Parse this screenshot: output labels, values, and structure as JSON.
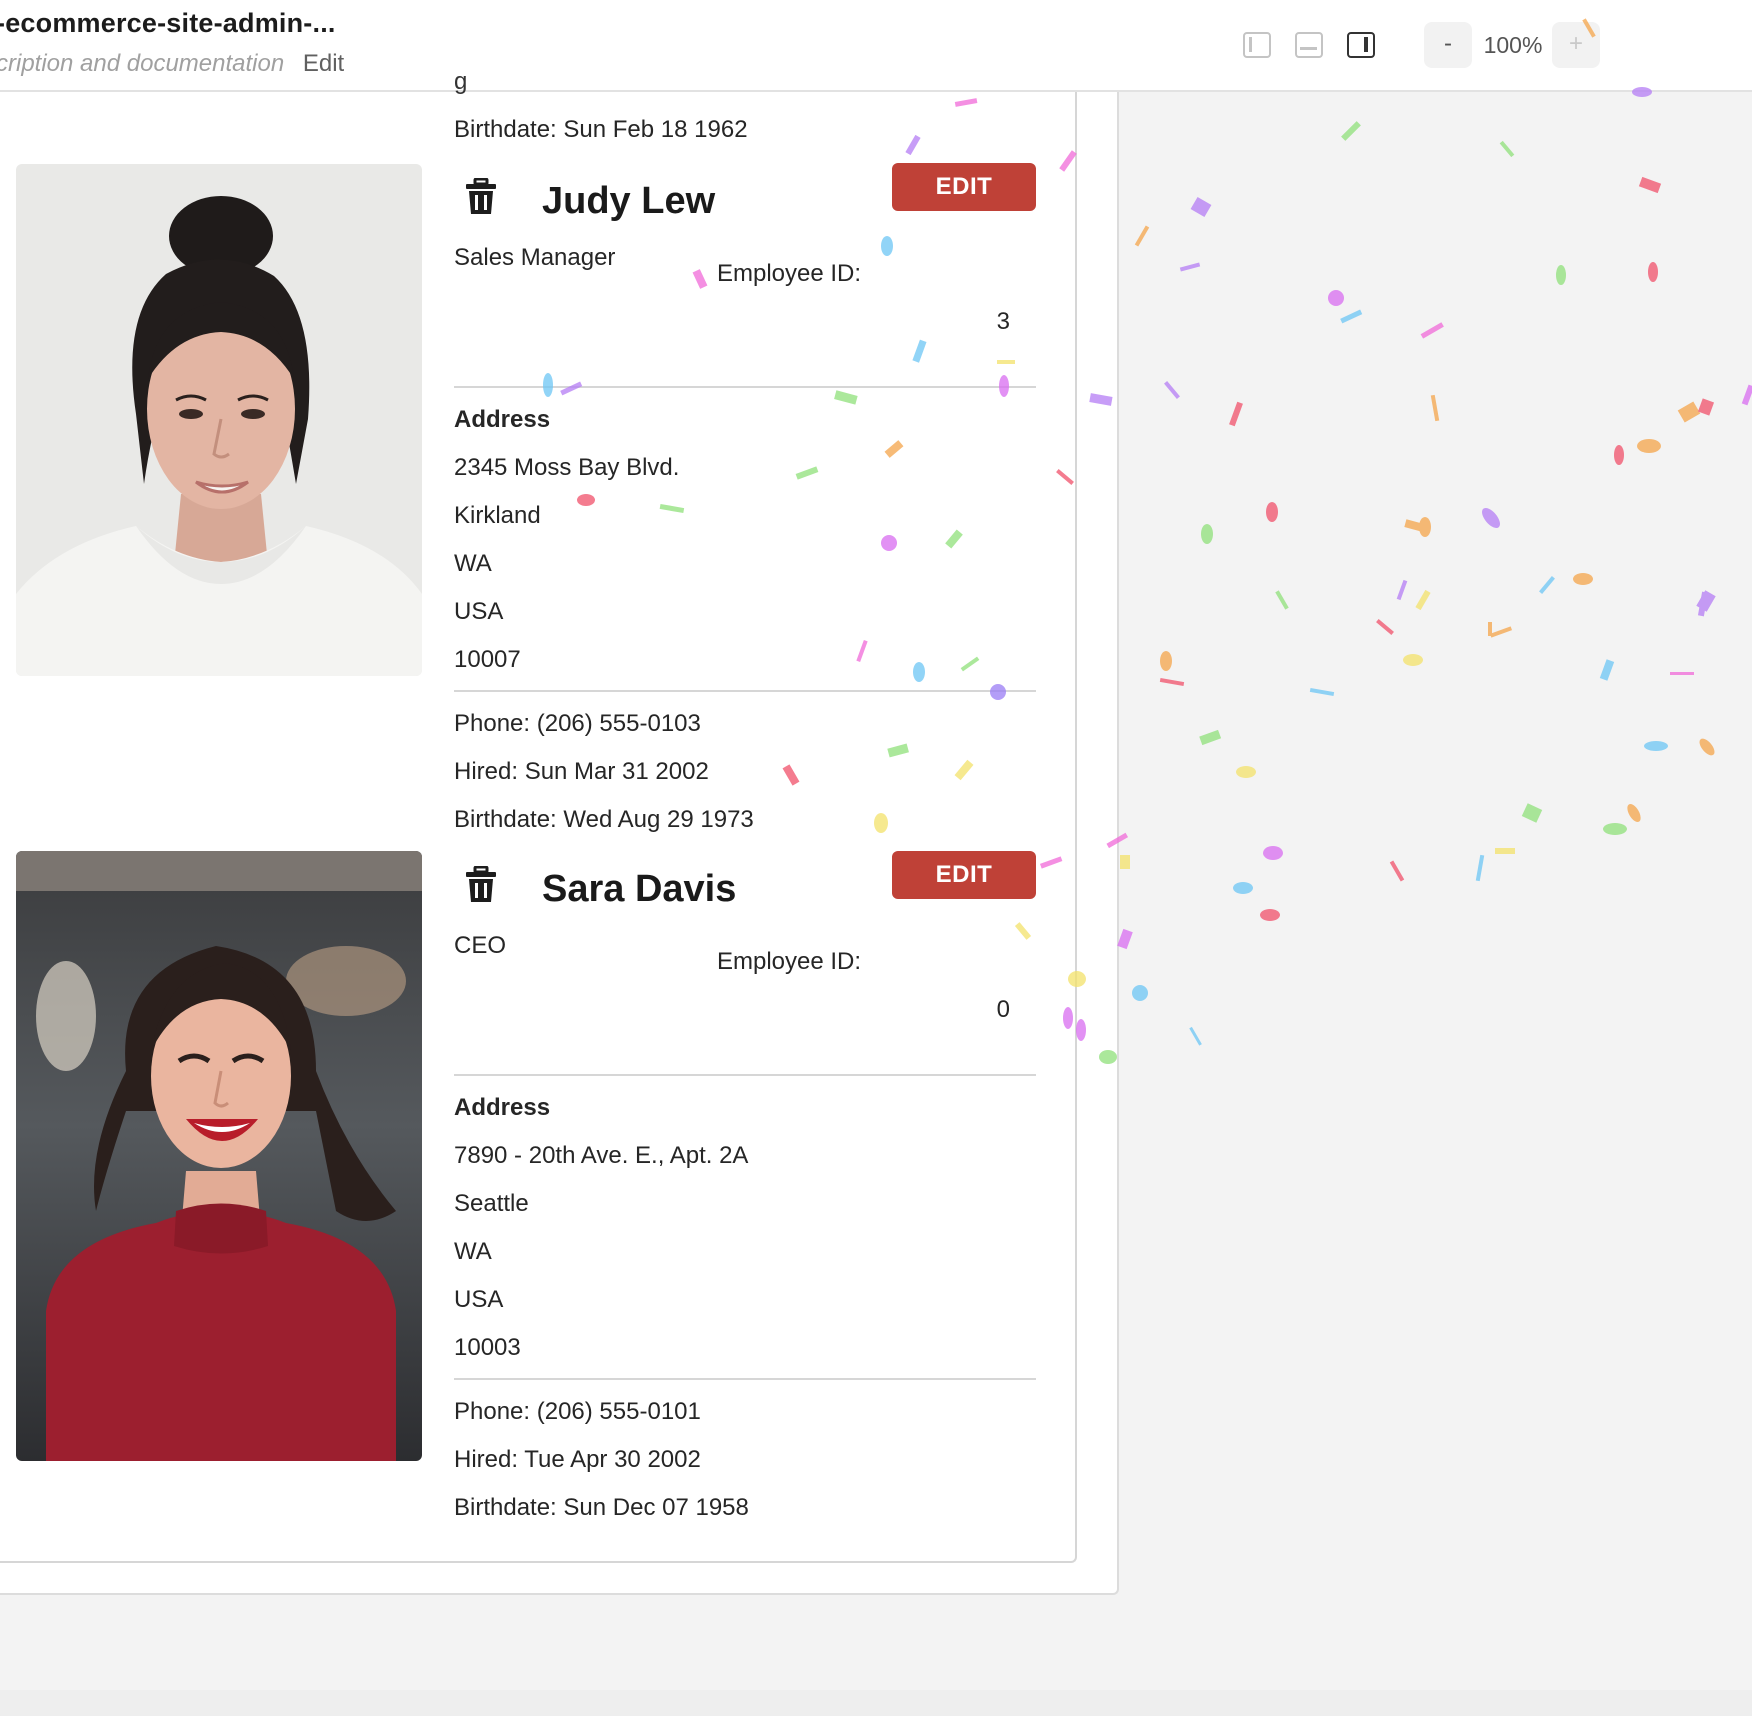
{
  "header": {
    "title": "-ecommerce-site-admin-...",
    "description_placeholder": "cription and documentation",
    "edit_label": "Edit",
    "zoom": {
      "minus_label": "-",
      "value": "100%",
      "plus_label": "+"
    }
  },
  "list": {
    "cut_line": "g",
    "previous_birthdate": "Birthdate: Sun Feb 18 1962",
    "employees": [
      {
        "name": "Judy Lew",
        "title": "Sales Manager",
        "id_label": "Employee ID:",
        "id": "3",
        "edit_label": "EDIT",
        "address_heading": "Address",
        "street": "2345 Moss Bay Blvd.",
        "city": "Kirkland",
        "region": "WA",
        "country": "USA",
        "postal": "10007",
        "phone": "Phone: (206) 555-0103",
        "hired": "Hired: Sun Mar 31 2002",
        "birthdate": "Birthdate: Wed Aug 29 1973"
      },
      {
        "name": "Sara Davis",
        "title": "CEO",
        "id_label": "Employee ID:",
        "id": "0",
        "edit_label": "EDIT",
        "address_heading": "Address",
        "street": "7890 - 20th Ave. E., Apt. 2A",
        "city": "Seattle",
        "region": "WA",
        "country": "USA",
        "postal": "10003",
        "phone": "Phone: (206) 555-0101",
        "hired": "Hired: Tue Apr 30 2002",
        "birthdate": "Birthdate: Sun Dec 07 1958"
      }
    ]
  },
  "icons": {
    "delete": "trash-icon",
    "layout_left": "panel-left-icon",
    "layout_bottom": "panel-bottom-icon",
    "layout_right": "panel-right-icon"
  },
  "colors": {
    "edit_button": "#bf4137",
    "background": "#f3f3f3"
  }
}
